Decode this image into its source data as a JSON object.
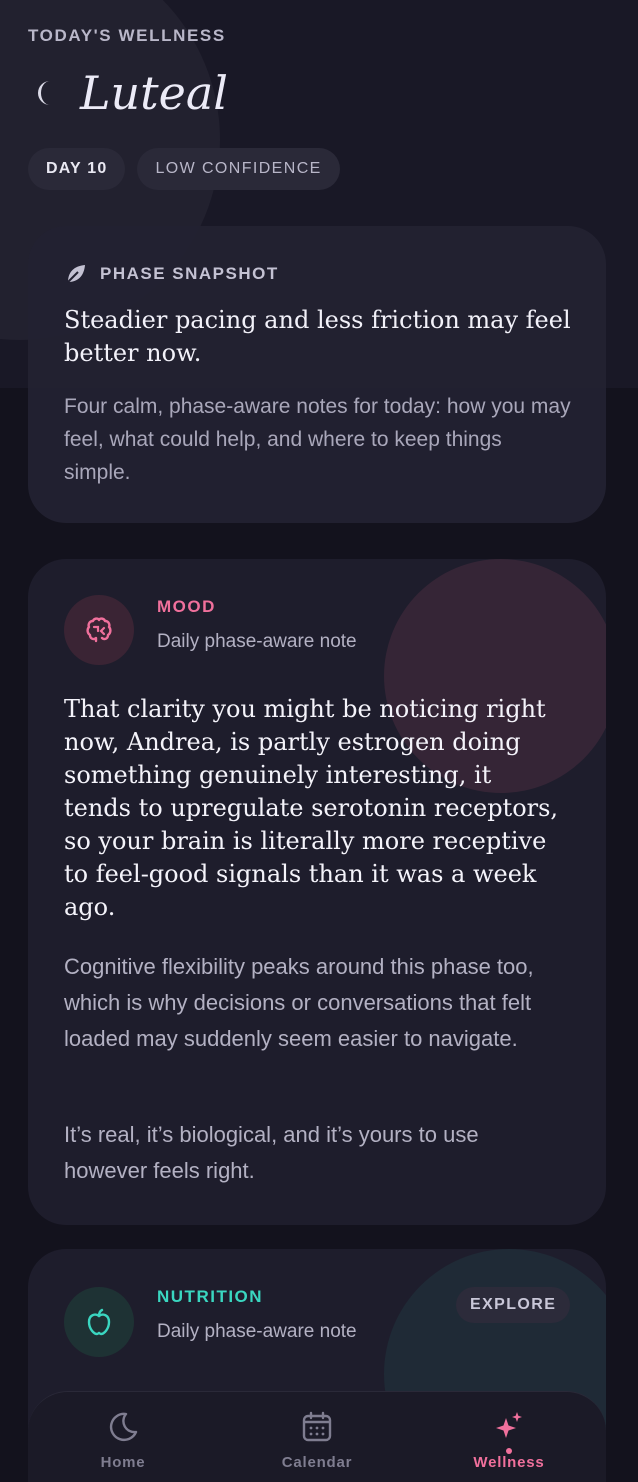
{
  "header": {
    "eyebrow": "TODAY'S WELLNESS",
    "phase": "Luteal",
    "phase_icon": "moon-icon",
    "chips": [
      "DAY 10",
      "LOW CONFIDENCE"
    ]
  },
  "snapshot": {
    "icon": "leaf-icon",
    "label": "PHASE SNAPSHOT",
    "title": "Steadier pacing and less friction may feel better now.",
    "body": "Four calm, phase-aware notes for today: how you may feel, what could help, and where to keep things simple."
  },
  "mood": {
    "icon": "brain-icon",
    "label": "MOOD",
    "subtitle": "Daily phase-aware note",
    "accent": "#f0709c",
    "main": "That clarity you might be noticing right now, Andrea, is partly estrogen doing something genuinely interesting, it tends to upregulate serotonin receptors, so your brain is literally more receptive to feel-good signals than it was a week ago.",
    "paragraph1": "Cognitive flexibility peaks around this phase too, which is why decisions or conversations that felt loaded may suddenly seem easier to navigate.",
    "paragraph2": "It’s real, it’s biological, and it’s yours to use however feels right."
  },
  "nutrition": {
    "icon": "apple-icon",
    "label": "NUTRITION",
    "subtitle": "Daily phase-aware note",
    "accent": "#3ad6c0",
    "explore_label": "EXPLORE",
    "peek": ""
  },
  "tabbar": {
    "items": [
      {
        "label": "Home",
        "icon": "moon-icon"
      },
      {
        "label": "Calendar",
        "icon": "calendar-icon"
      },
      {
        "label": "Wellness",
        "icon": "sparkle-icon",
        "active": true
      }
    ]
  }
}
